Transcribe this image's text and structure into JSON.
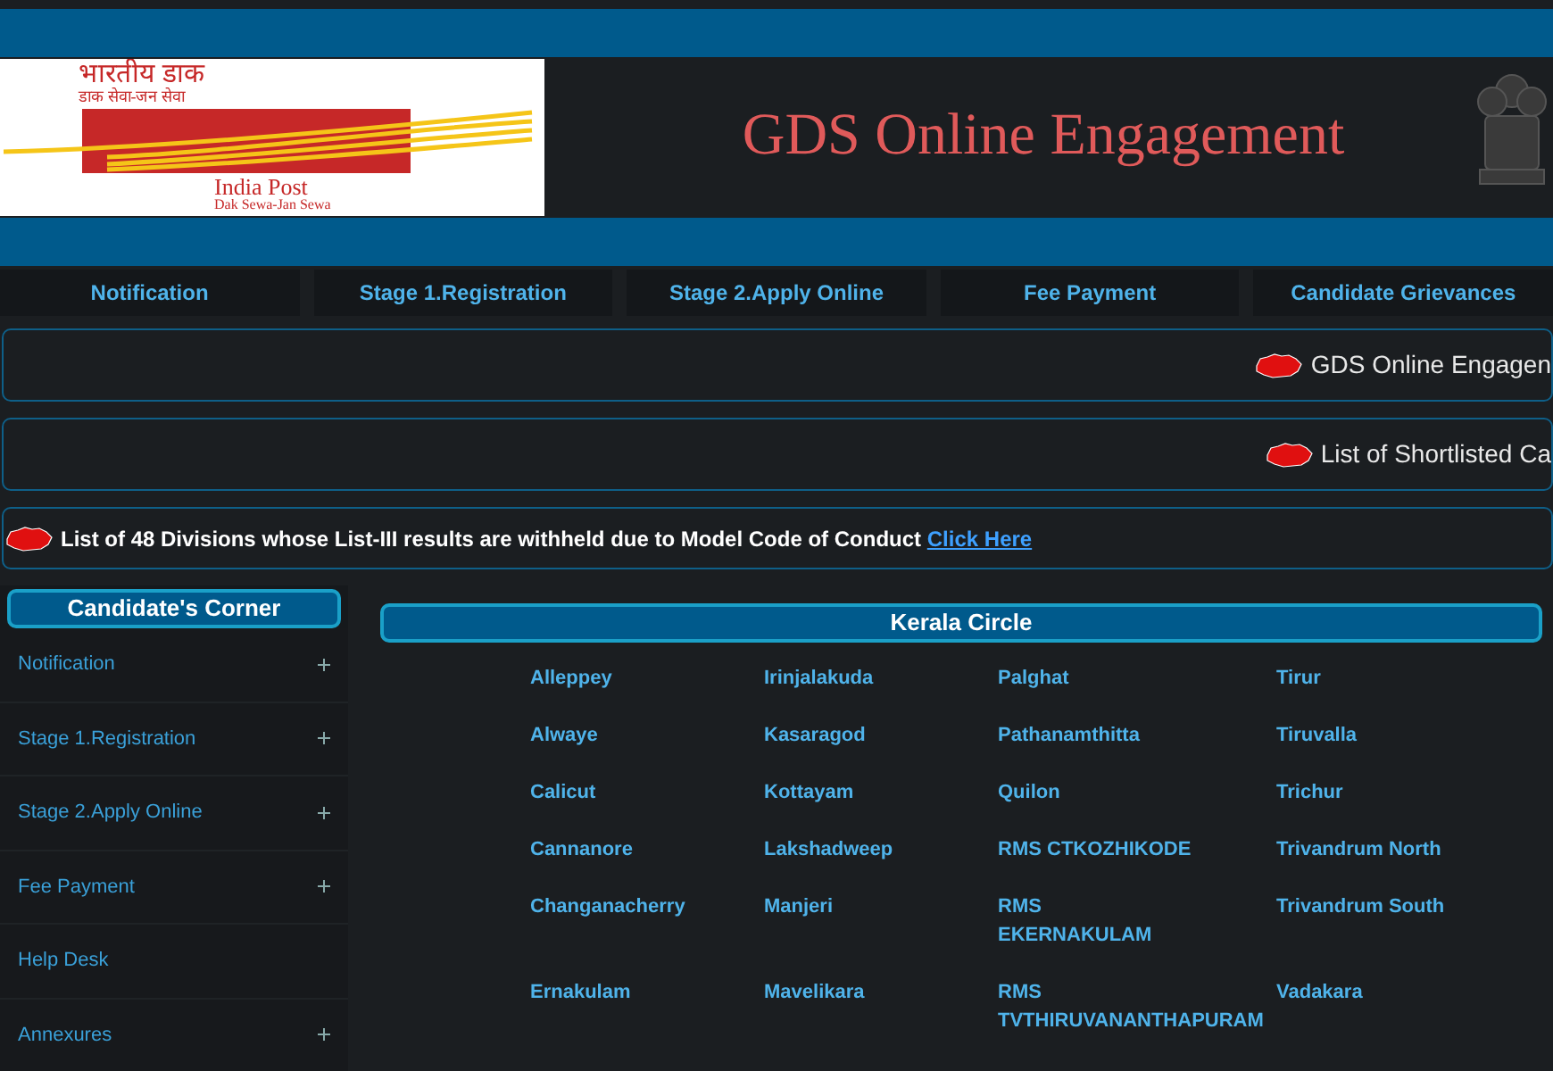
{
  "header": {
    "logo": {
      "hindi_name": "भारतीय डाक",
      "hindi_tagline": "डाक सेवा-जन सेवा",
      "name": "India Post",
      "tagline": "Dak Sewa-Jan Sewa"
    },
    "title": "GDS Online Engagement"
  },
  "nav": [
    {
      "label": "Notification"
    },
    {
      "label": "Stage 1.Registration"
    },
    {
      "label": "Stage 2.Apply Online"
    },
    {
      "label": "Fee Payment"
    },
    {
      "label": "Candidate Grievances"
    }
  ],
  "notices": [
    {
      "text": "GDS Online Engagen"
    },
    {
      "text": "List of Shortlisted Ca"
    },
    {
      "text": "List of 48 Divisions whose List-III results are withheld due to Model Code of Conduct",
      "link": "Click Here"
    }
  ],
  "sidebar": {
    "title": "Candidate's Corner",
    "items": [
      {
        "label": "Notification",
        "expandable": true
      },
      {
        "label": "Stage 1.Registration",
        "expandable": true
      },
      {
        "label": "Stage 2.Apply Online",
        "expandable": true
      },
      {
        "label": "Fee Payment",
        "expandable": true
      },
      {
        "label": "Help Desk",
        "expandable": false
      },
      {
        "label": "Annexures",
        "expandable": true
      }
    ]
  },
  "circle": {
    "title": "Kerala Circle",
    "divisions": [
      [
        "Alleppey",
        "Irinjalakuda",
        "Palghat",
        "Tirur"
      ],
      [
        "Alwaye",
        "Kasaragod",
        "Pathanamthitta",
        "Tiruvalla"
      ],
      [
        "Calicut",
        "Kottayam",
        "Quilon",
        "Trichur"
      ],
      [
        "Cannanore",
        "Lakshadweep",
        "RMS CTKOZHIKODE",
        "Trivandrum North"
      ],
      [
        "Changanacherry",
        "Manjeri",
        "RMS EKERNAKULAM",
        "Trivandrum South"
      ],
      [
        "Ernakulam",
        "Mavelikara",
        "RMS TVTHIRUVANANTHAPURAM",
        "Vadakara"
      ]
    ]
  }
}
